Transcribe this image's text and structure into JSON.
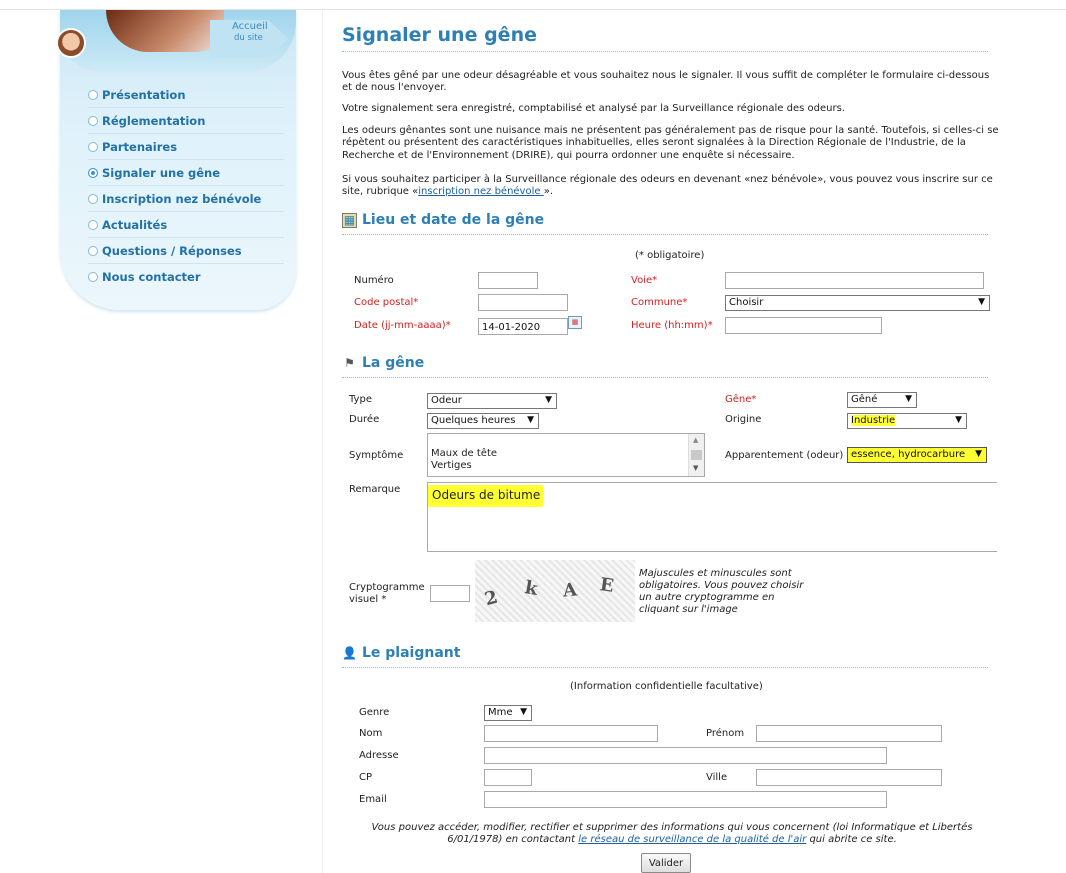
{
  "sidebar": {
    "accueil_line1": "Accueil",
    "accueil_line2": "du site",
    "items": [
      {
        "label": "Présentation"
      },
      {
        "label": "Réglementation"
      },
      {
        "label": "Partenaires"
      },
      {
        "label": "Signaler une gêne"
      },
      {
        "label": "Inscription nez bénévole"
      },
      {
        "label": "Actualités"
      },
      {
        "label": "Questions / Réponses"
      },
      {
        "label": "Nous contacter"
      }
    ]
  },
  "page": {
    "title": "Signaler une gêne",
    "intro1": "Vous êtes gêné par une odeur désagréable et vous souhaitez nous le signaler. Il vous suffit de compléter le formulaire ci-dessous et de nous l'envoyer.",
    "intro2": "Votre signalement sera enregistré, comptabilisé et analysé par la Surveillance régionale des odeurs.",
    "intro3": "Les odeurs gênantes sont une nuisance mais ne présentent pas généralement pas de risque pour la santé. Toutefois, si celles-ci se répètent ou présentent des caractéristiques inhabituelles, elles seront signalées à la Direction Régionale de l'Industrie, de la Recherche et de l'Environnement (DRIRE), qui pourra ordonner une enquête si nécessaire.",
    "intro4_before": "Si vous souhaitez participer à la Surveillance régionale des odeurs en devenant «nez bénévole», vous pouvez vous inscrire sur ce site, rubrique «",
    "intro4_link": "inscription nez bénévole ",
    "intro4_after": "»."
  },
  "lieu": {
    "section_title": "Lieu et date de la gêne",
    "required_note": "(* obligatoire)",
    "numero_label": "Numéro",
    "numero_value": "",
    "voie_label": "Voie*",
    "voie_value": "",
    "cp_label": "Code postal*",
    "cp_value": "",
    "commune_label": "Commune*",
    "commune_value": "Choisir",
    "date_label": "Date (jj-mm-aaaa)*",
    "date_value": "14-01-2020",
    "heure_label": "Heure (hh:mm)*",
    "heure_value": ""
  },
  "gene": {
    "section_title": "La gêne",
    "type_label": "Type",
    "type_value": "Odeur",
    "gene_label": "Gêne*",
    "gene_value": "Gêné",
    "duree_label": "Durée",
    "duree_value": "Quelques heures",
    "origine_label": "Origine",
    "origine_value": "Industrie",
    "symptome_label": "Symptôme",
    "symptome_options": [
      "Maux de tête",
      "Vertiges"
    ],
    "apparentement_label": "Apparentement (odeur)",
    "apparentement_value": "essence, hydrocarbure",
    "remarque_label": "Remarque",
    "remarque_value": "Odeurs de bitume",
    "crypto_label_1": "Cryptogramme",
    "crypto_label_2": "visuel *",
    "captcha_text": [
      "2",
      "k",
      "A",
      "E"
    ],
    "crypto_help": "Majuscules et minuscules sont obligatoires. Vous pouvez choisir un autre cryptogramme en cliquant sur l'image"
  },
  "plaignant": {
    "section_title": "Le plaignant",
    "note": "(Information confidentielle facultative)",
    "genre_label": "Genre",
    "genre_value": "Mme",
    "nom_label": "Nom",
    "prenom_label": "Prénom",
    "adresse_label": "Adresse",
    "cp_label": "CP",
    "ville_label": "Ville",
    "email_label": "Email",
    "footer_1": "Vous pouvez accéder, modifier, rectifier et supprimer des informations qui vous concernent (loi Informatique et Libertés 6/01/1978) en contactant ",
    "footer_link": "le réseau de surveillance de la qualité de l'air",
    "footer_2": " qui abrite ce site.",
    "submit_label": "Valider"
  }
}
